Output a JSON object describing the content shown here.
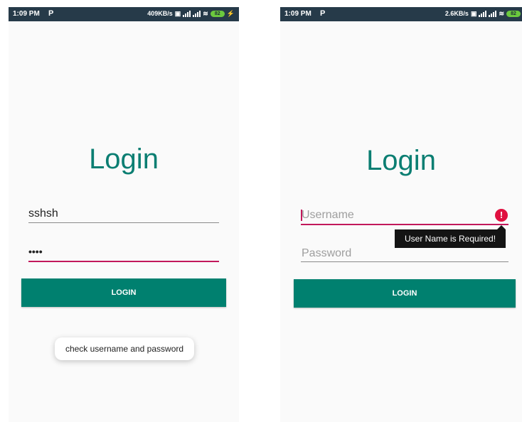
{
  "left_screen": {
    "status_bar": {
      "time": "1:09 PM",
      "carrier_icon": "P",
      "network_speed": "409KB/s",
      "battery": "82"
    },
    "title": "Login",
    "username_value": "sshsh",
    "password_value": "••••",
    "login_button": "LOGIN",
    "toast_message": "check username and password"
  },
  "right_screen": {
    "status_bar": {
      "time": "1:09 PM",
      "carrier_icon": "P",
      "network_speed": "2.6KB/s",
      "battery": "82"
    },
    "title": "Login",
    "username_placeholder": "Username",
    "password_placeholder": "Password",
    "login_button": "LOGIN",
    "error_message": "User Name is Required!",
    "error_icon": "exclamation-icon"
  },
  "colors": {
    "accent": "#00806f",
    "focus_underline": "#c2185b",
    "error": "#e01040",
    "status_bar": "#263a49"
  }
}
